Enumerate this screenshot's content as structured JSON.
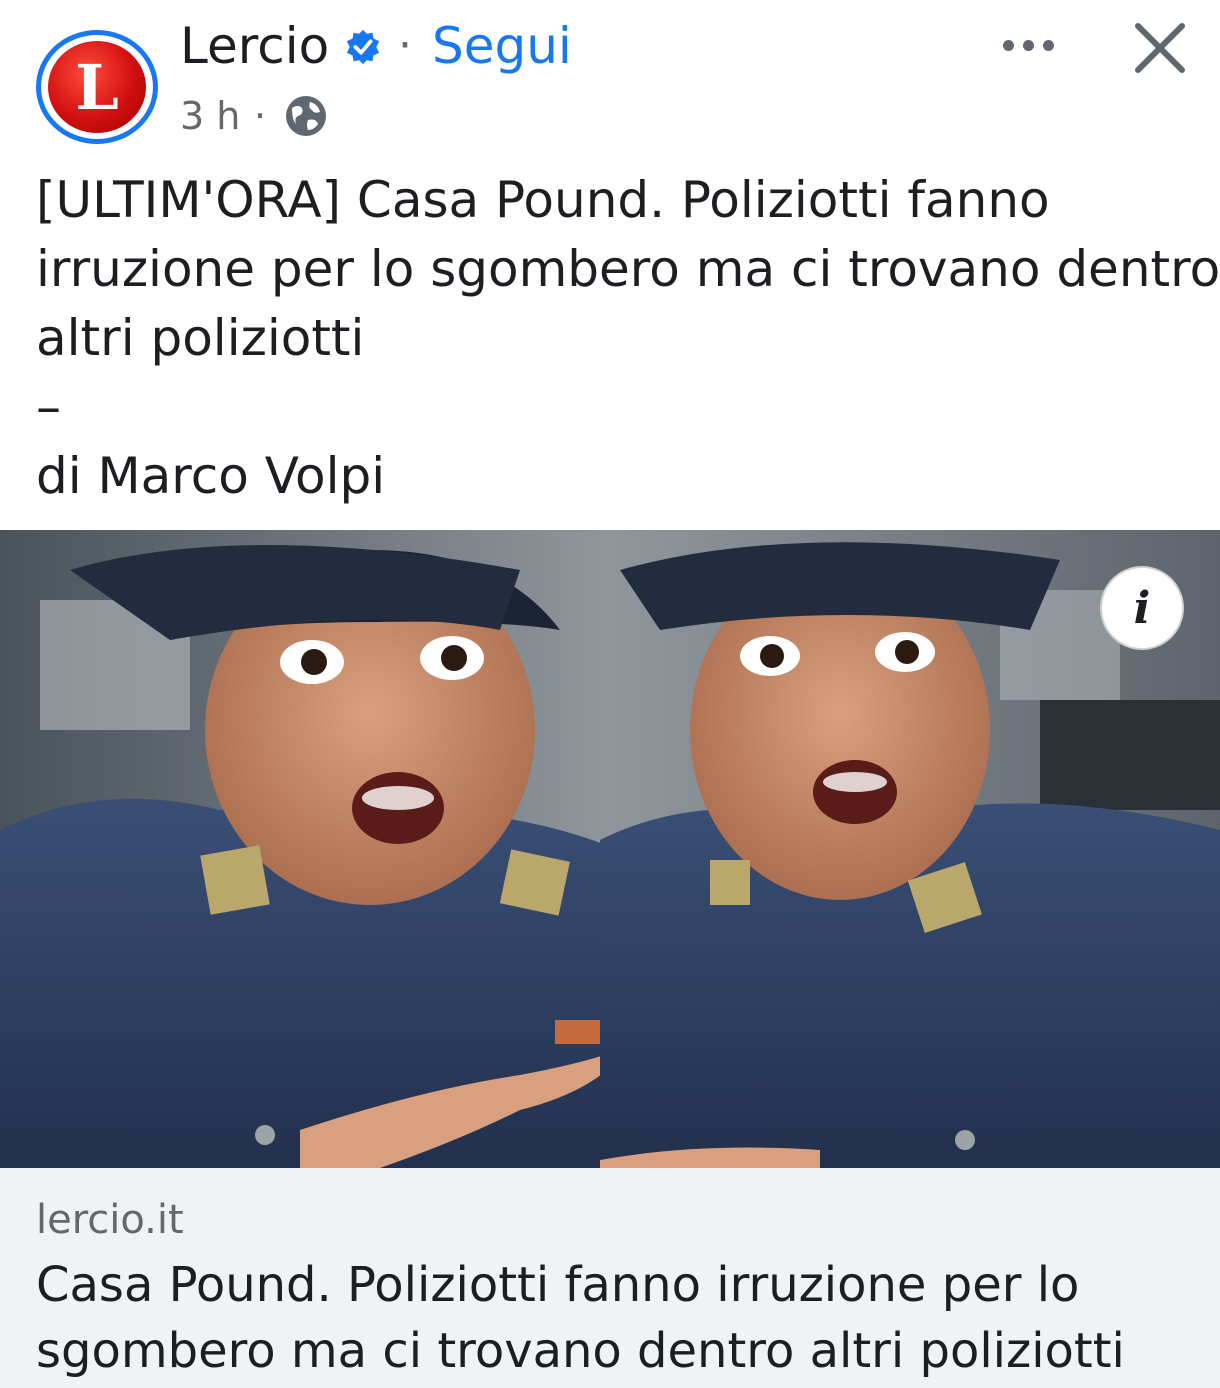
{
  "header": {
    "avatar_letter": "L",
    "page_name": "Lercio",
    "separator": "·",
    "follow_label": "Segui",
    "time": "3 h",
    "time_separator": "·",
    "verified_icon": "verified-badge-icon",
    "audience_icon": "globe-icon",
    "more_icon": "more-options-icon",
    "close_icon": "close-icon"
  },
  "post": {
    "lines": [
      "[ULTIM'ORA] Casa Pound. Poliziotti fanno",
      "irruzione per lo sgombero ma ci trovano dentro",
      "altri poliziotti",
      "–",
      "di Marco Volpi"
    ]
  },
  "media": {
    "info_label": "i"
  },
  "link_preview": {
    "domain": "lercio.it",
    "title_lines": [
      "Casa Pound. Poliziotti fanno irruzione per lo",
      "sgombero ma ci trovano dentro altri poliziotti"
    ]
  },
  "colors": {
    "accent": "#1877f2",
    "text": "#1c1e21",
    "secondary": "#65676b",
    "preview_bg": "#f0f2f5",
    "brand_red": "#d10f0f"
  }
}
